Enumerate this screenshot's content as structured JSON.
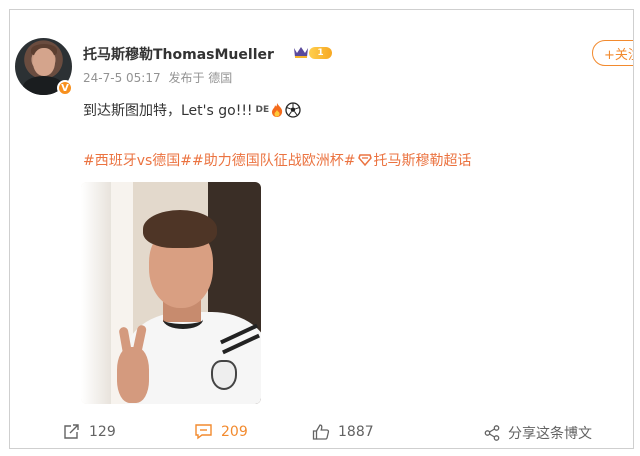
{
  "user": {
    "name": "托马斯穆勒ThomasMueller",
    "level": "1",
    "verified_mark": "V"
  },
  "follow_button": {
    "label": "+关注"
  },
  "meta": {
    "timestamp": "24-7-5 05:17",
    "source": "发布于 德国"
  },
  "post": {
    "text": "到达斯图加特，Let's go!!!",
    "flag_text": "DE"
  },
  "hashtags": {
    "text": "#西班牙vs德国##助力德国队征战欧洲杯#",
    "super_topic": "托马斯穆勒超话"
  },
  "actions": {
    "reposts": "129",
    "comments": "209",
    "likes": "1887",
    "share_label": "分享这条博文"
  },
  "colors": {
    "accent": "#f28a2e",
    "hashtag": "#eb7340",
    "meta": "#939393"
  },
  "icons": [
    "crown-icon",
    "fire-icon",
    "soccer-ball-icon",
    "super-topic-icon",
    "repost-icon",
    "comment-icon",
    "like-icon",
    "share-icon"
  ]
}
